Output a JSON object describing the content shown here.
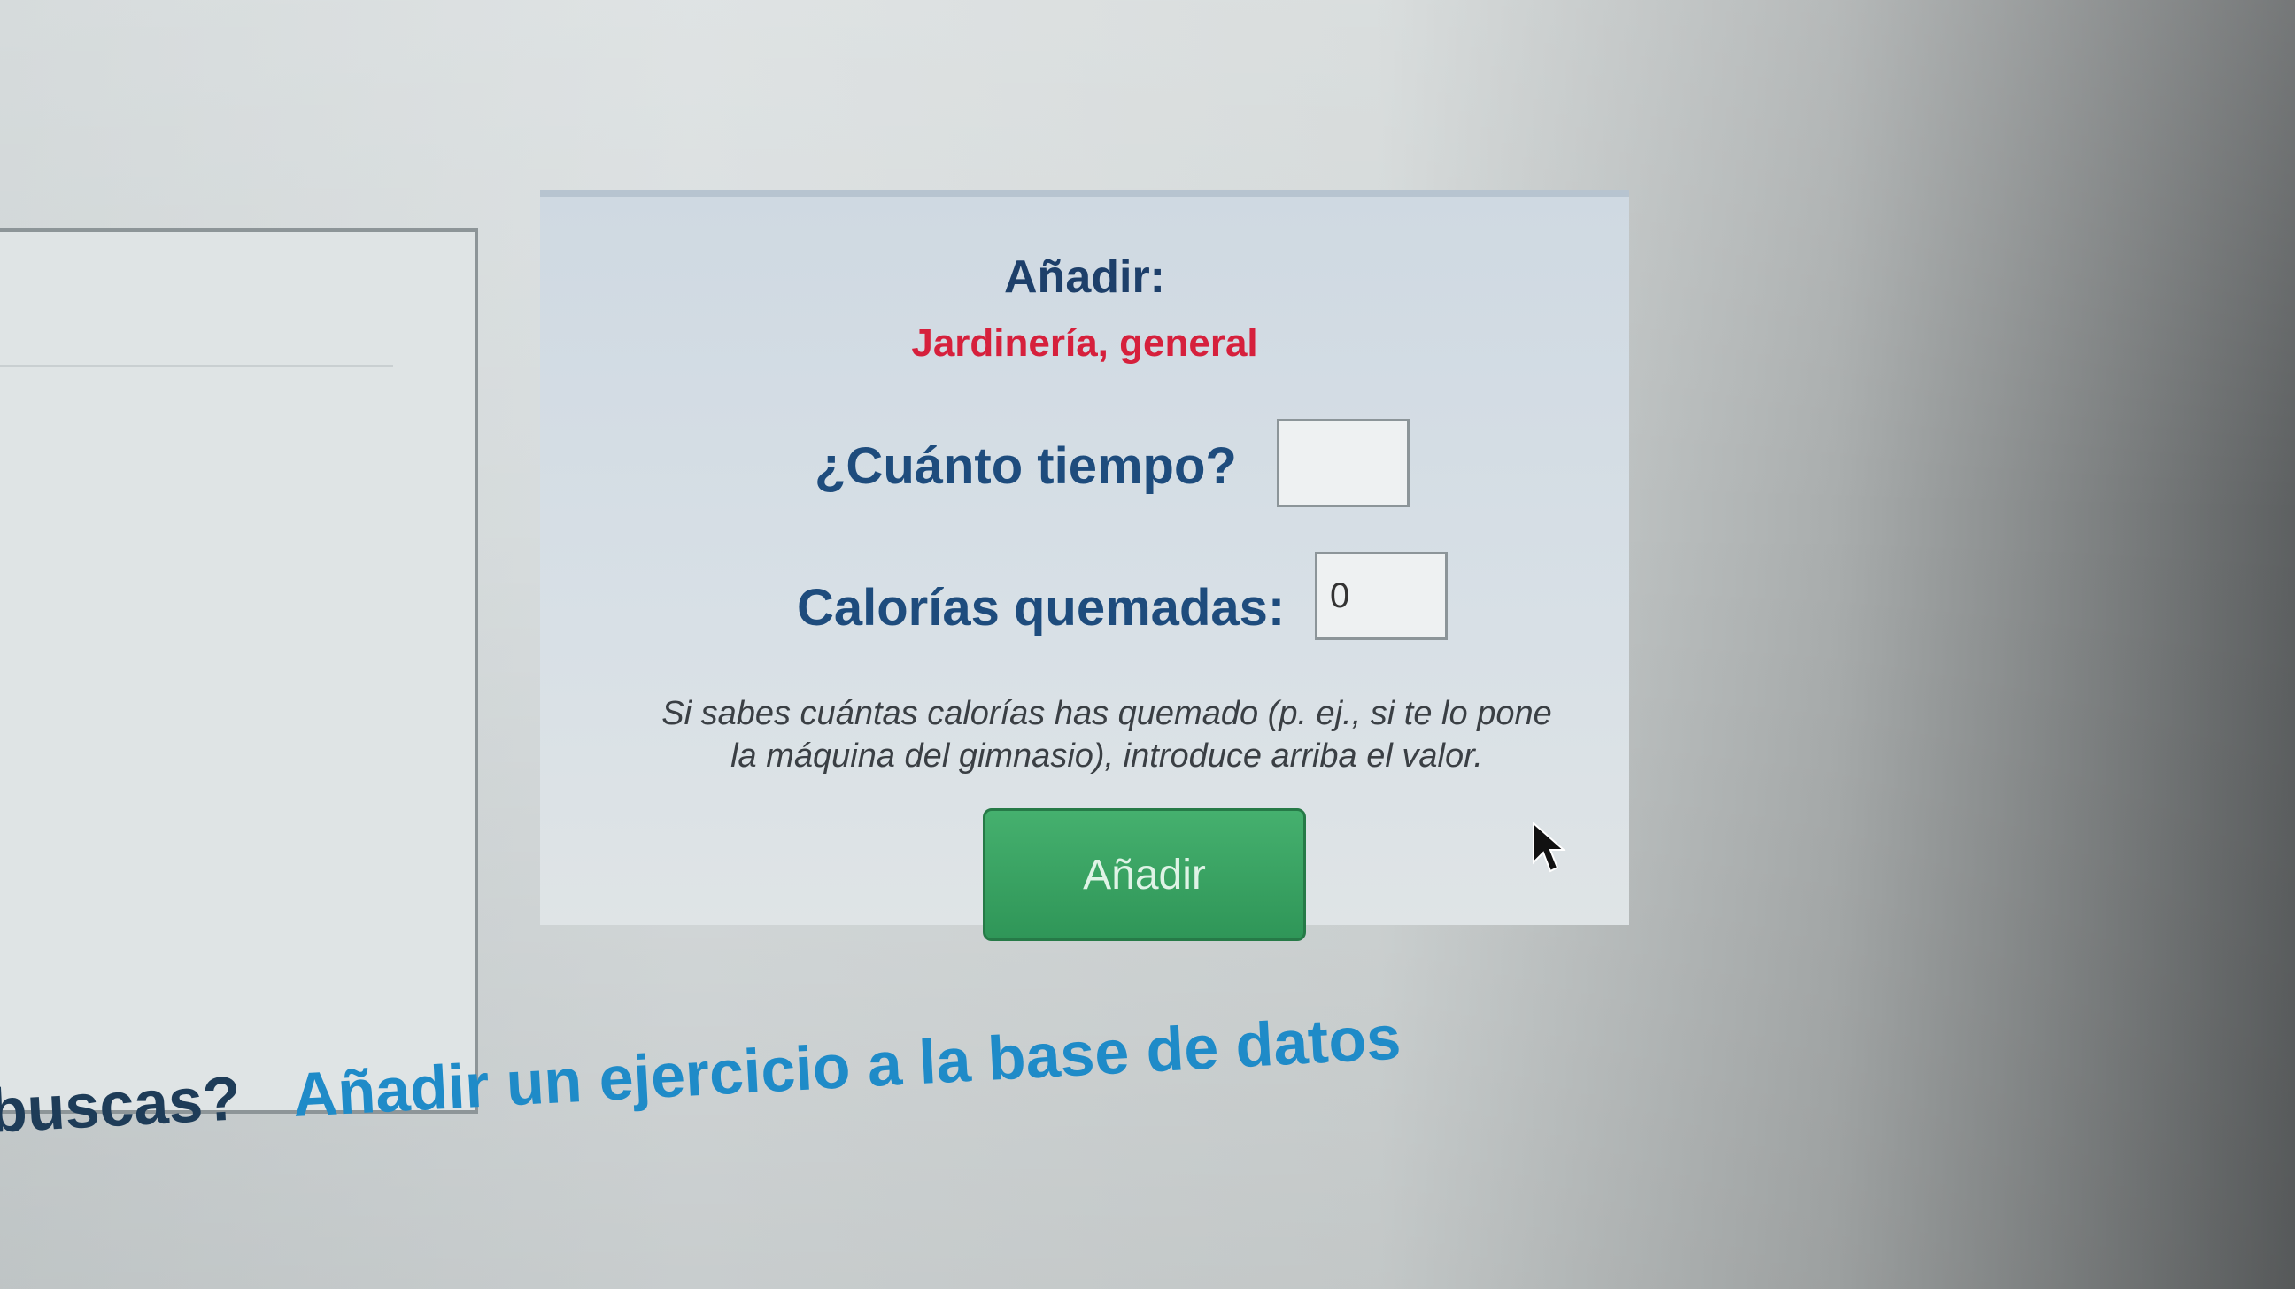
{
  "panel": {
    "title": "Añadir:",
    "activity": "Jardinería, general"
  },
  "form": {
    "time_label": "¿Cuánto tiempo?",
    "time_value": "",
    "calories_label": "Calorías quemadas:",
    "calories_value": "0",
    "help_line1": "Si sabes cuántas calorías has quemado (p. ej., si te lo pone",
    "help_line2": "la máquina del gimnasio), introduce arriba el valor.",
    "submit_label": "Añadir"
  },
  "footer": {
    "question": "buscas?",
    "link_label": "Añadir un ejercicio a la base de datos"
  },
  "icons": {
    "cursor": "mouse-pointer-icon"
  },
  "colors": {
    "title": "#1d3f6a",
    "activity": "#d6203c",
    "button": "#35a05f",
    "link": "#1f8bc8"
  }
}
